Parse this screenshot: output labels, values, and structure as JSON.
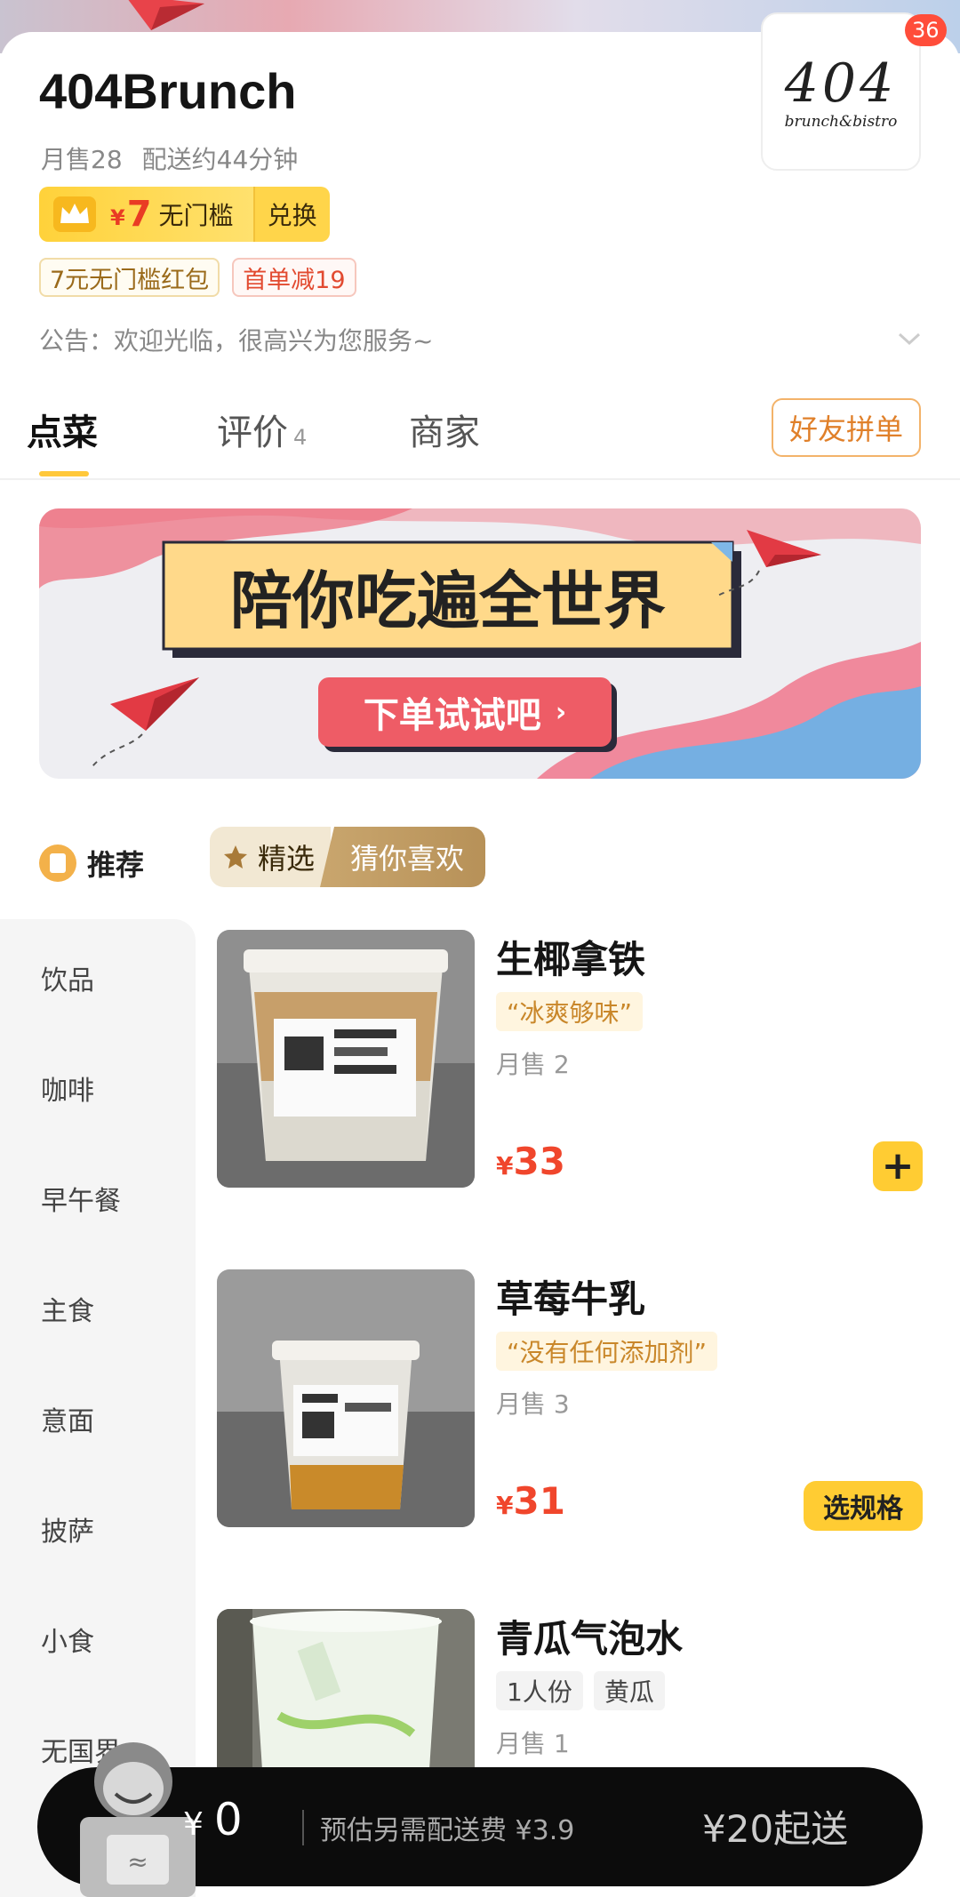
{
  "shop": {
    "name": "404Brunch",
    "monthly_sales": "月售28",
    "delivery_time": "配送约44分钟",
    "logo_main": "404",
    "logo_sub": "brunch&bistro",
    "badge_count": "36"
  },
  "vip": {
    "yen": "¥",
    "amount": "7",
    "text": "无门槛",
    "redeem": "兑换"
  },
  "coupons": [
    "7元无门槛红包",
    "首单减19"
  ],
  "notice": "公告：欢迎光临，很高兴为您服务~",
  "tabs": [
    {
      "label": "点菜"
    },
    {
      "label": "评价",
      "count": "4"
    },
    {
      "label": "商家"
    }
  ],
  "group_order": "好友拼单",
  "banner": {
    "headline": "陪你吃遍全世界",
    "cta": "下单试试吧"
  },
  "category_header": "推荐",
  "filters": [
    "精选",
    "猜你喜欢"
  ],
  "sidebar": [
    "饮品",
    "咖啡",
    "早午餐",
    "主食",
    "意面",
    "披萨",
    "小食",
    "无国界"
  ],
  "products": [
    {
      "name": "生椰拿铁",
      "slogan": "“冰爽够味”",
      "sold": "月售 2",
      "yen": "¥",
      "price": "33",
      "action": "+"
    },
    {
      "name": "草莓牛乳",
      "slogan": "“没有任何添加剂”",
      "sold": "月售 3",
      "yen": "¥",
      "price": "31",
      "action": "选规格"
    },
    {
      "name": "青瓜气泡水",
      "tags": [
        "1人份",
        "黄瓜"
      ],
      "sold": "月售 1"
    }
  ],
  "cart": {
    "yen": "¥",
    "total": "0",
    "delivery_fee": "预估另需配送费 ¥3.9",
    "min_order": "¥20起送"
  },
  "colors": {
    "accent_yellow": "#ffcc33",
    "price_red": "#f0462c",
    "cart_bar": "#0c0c0c"
  }
}
